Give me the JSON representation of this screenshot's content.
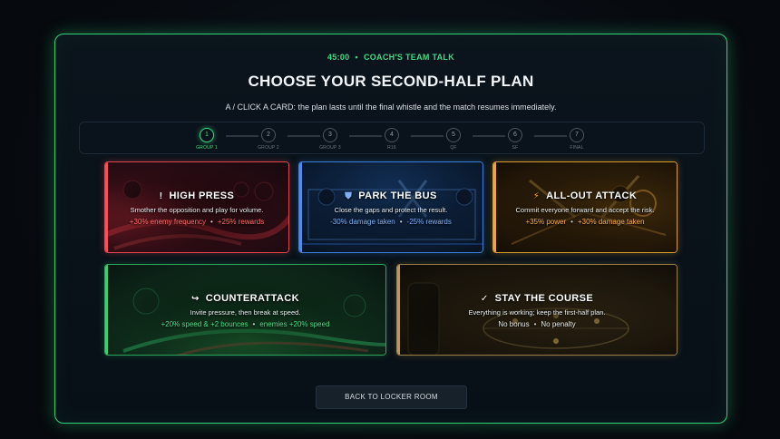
{
  "header": {
    "time": "45:00",
    "separator": "•",
    "section": "COACH'S TEAM TALK",
    "title": "CHOOSE YOUR SECOND-HALF PLAN",
    "subtitle": "A / CLICK A CARD: the plan lasts until the final whistle and the match resumes immediately."
  },
  "stepper": {
    "steps": [
      {
        "num": "1",
        "label": "GROUP 1",
        "active": true
      },
      {
        "num": "2",
        "label": "GROUP 2",
        "active": false
      },
      {
        "num": "3",
        "label": "GROUP 3",
        "active": false
      },
      {
        "num": "4",
        "label": "R16",
        "active": false
      },
      {
        "num": "5",
        "label": "QF",
        "active": false
      },
      {
        "num": "6",
        "label": "SF",
        "active": false
      },
      {
        "num": "7",
        "label": "FINAL",
        "active": false
      }
    ]
  },
  "cards": {
    "high_press": {
      "icon": "!",
      "icon_name": "exclamation-icon",
      "name": "HIGH PRESS",
      "desc": "Smother the opposition and play for volume.",
      "effect_a": "+30% enemy frequency",
      "effect_b": "+25% rewards",
      "color": "#e0454f"
    },
    "park_the_bus": {
      "icon": "⛊",
      "icon_name": "shield-icon",
      "name": "PARK THE BUS",
      "desc": "Close the gaps and protect the result.",
      "effect_a": "-30% damage taken",
      "effect_b": "-25% rewards",
      "color": "#3b7ed8"
    },
    "all_out_attack": {
      "icon": "⚡",
      "icon_name": "lightning-icon",
      "name": "ALL-OUT ATTACK",
      "desc": "Commit everyone forward and accept the risk.",
      "effect_a": "+35% power",
      "effect_b": "+30% damage taken",
      "color": "#d89a2b"
    },
    "counterattack": {
      "icon": "↪",
      "icon_name": "counter-arrow-icon",
      "name": "COUNTERATTACK",
      "desc": "Invite pressure, then break at speed.",
      "effect_a": "+20% speed & +2 bounces",
      "effect_b": "enemies +20% speed",
      "color": "#2aa65e"
    },
    "stay_the_course": {
      "icon": "✓",
      "icon_name": "checkmark-icon",
      "name": "STAY THE COURSE",
      "desc": "Everything is working; keep the first-half plan.",
      "effect_a": "No bonus",
      "effect_b": "No penalty",
      "color": "#9a7f45"
    }
  },
  "footer": {
    "back_label": "BACK TO LOCKER ROOM"
  }
}
